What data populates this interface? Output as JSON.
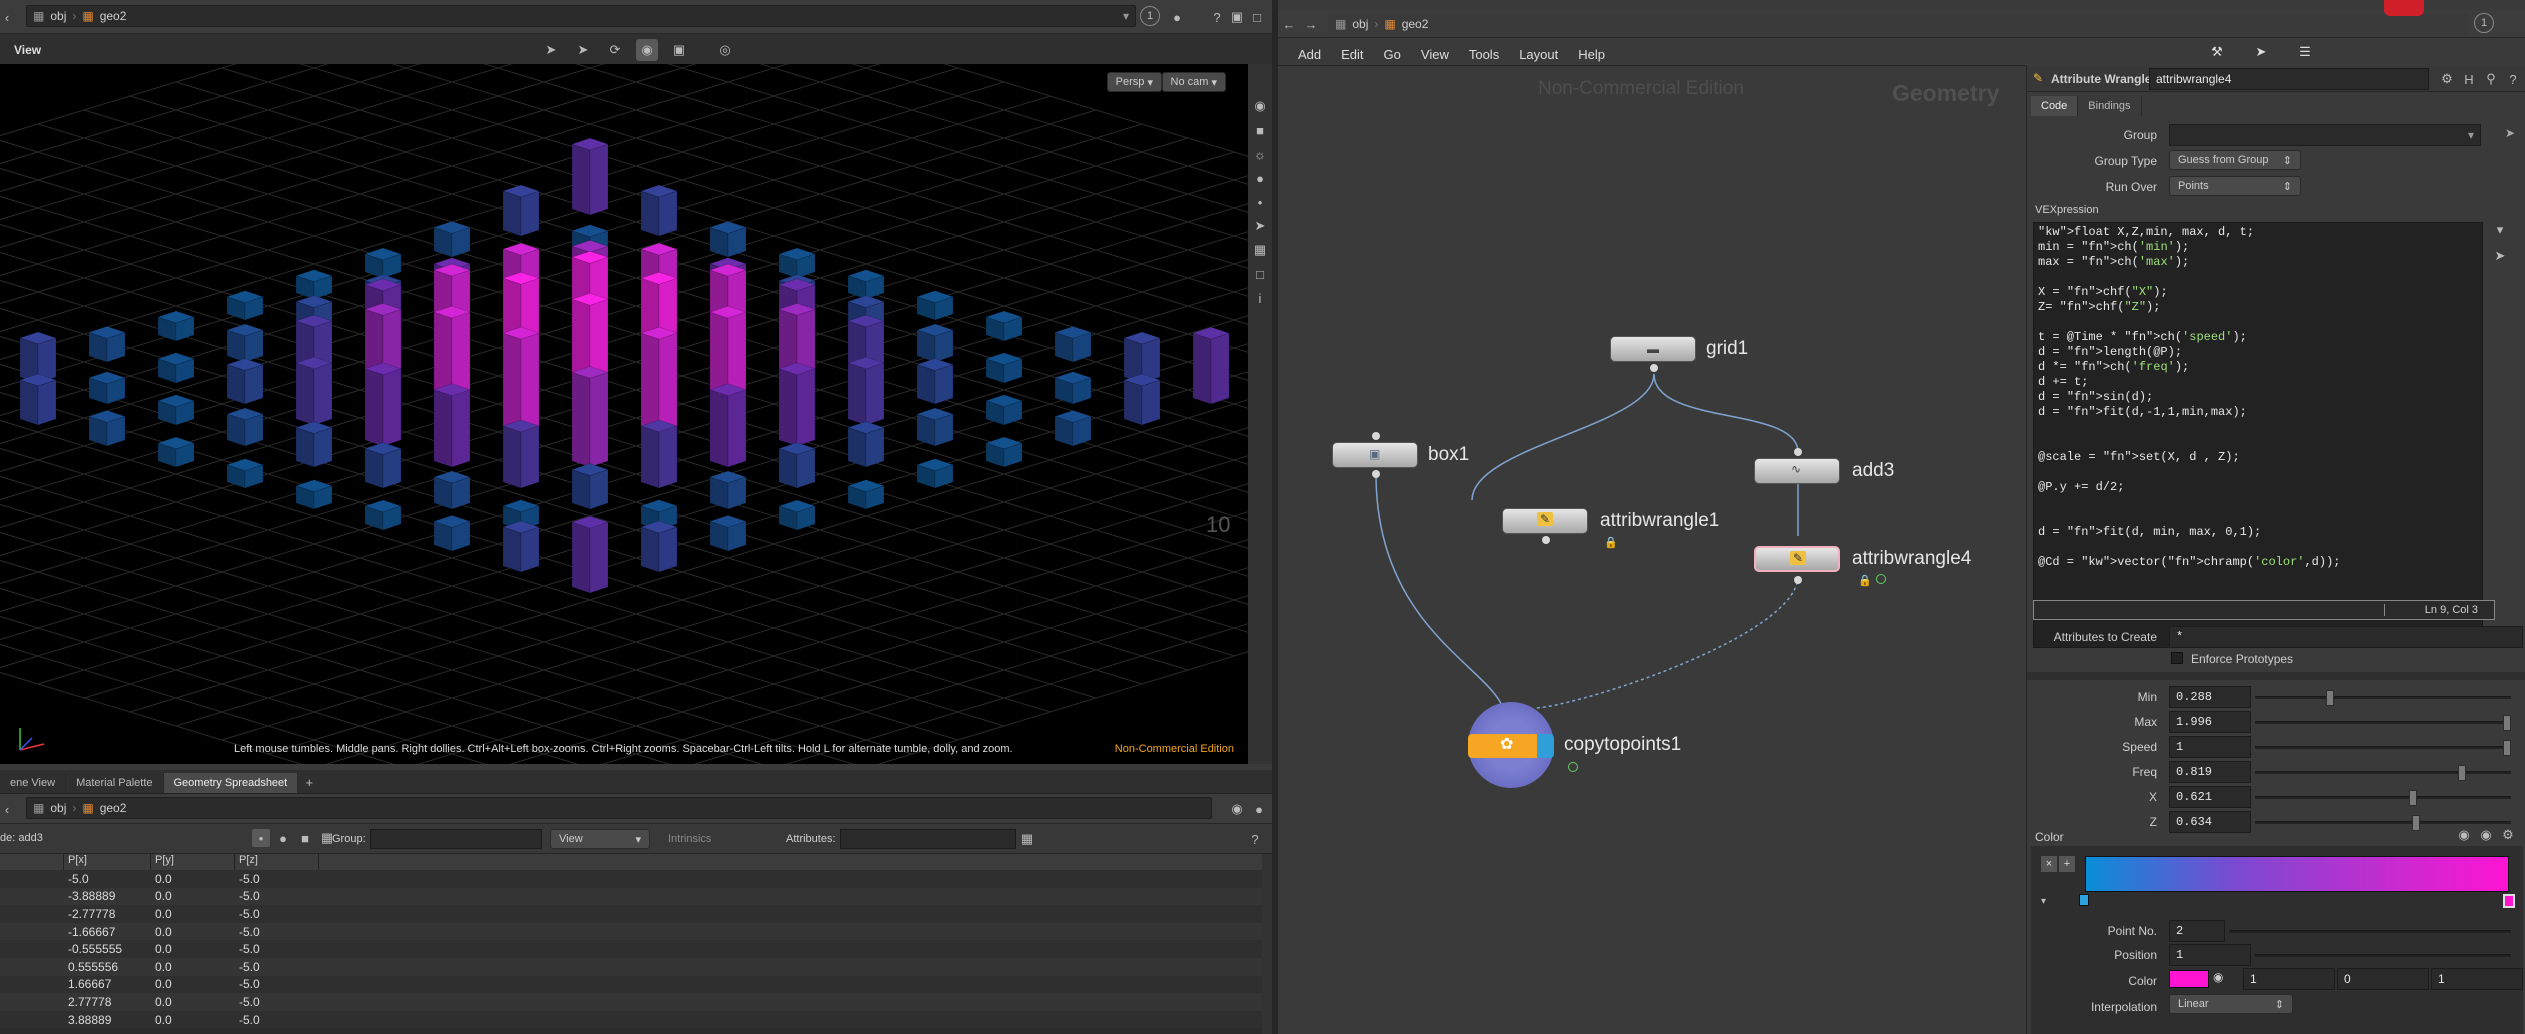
{
  "left_path": {
    "root": "obj",
    "node": "geo2"
  },
  "viewport": {
    "label": "View",
    "camera_persp": "Persp",
    "camera_name": "No cam",
    "status_hint": "Left mouse tumbles. Middle pans. Right dollies. Ctrl+Alt+Left box-zooms. Ctrl+Right zooms. Spacebar-Ctrl-Left tilts. Hold L for alternate tumble, dolly, and zoom.",
    "edition": "Non-Commercial Edition",
    "grid_text_a": "10",
    "grid_text_b": "10"
  },
  "bottom_tabs": [
    "ene View",
    "Material Palette",
    "Geometry Spreadsheet"
  ],
  "sheet": {
    "path": {
      "root": "obj",
      "node": "geo2"
    },
    "node_label": "de: add3",
    "group_label": "Group:",
    "view_label": "View",
    "intrinsics_label": "Intrinsics",
    "attributes_label": "Attributes:",
    "columns": [
      "P[x]",
      "P[y]",
      "P[z]"
    ],
    "rows": [
      [
        "-5.0",
        "0.0",
        "-5.0"
      ],
      [
        "-3.88889",
        "0.0",
        "-5.0"
      ],
      [
        "-2.77778",
        "0.0",
        "-5.0"
      ],
      [
        "-1.66667",
        "0.0",
        "-5.0"
      ],
      [
        "-0.555555",
        "0.0",
        "-5.0"
      ],
      [
        "0.555556",
        "0.0",
        "-5.0"
      ],
      [
        "1.66667",
        "0.0",
        "-5.0"
      ],
      [
        "2.77778",
        "0.0",
        "-5.0"
      ],
      [
        "3.88889",
        "0.0",
        "-5.0"
      ]
    ]
  },
  "network": {
    "path": {
      "root": "obj",
      "node": "geo2"
    },
    "menu": [
      "Add",
      "Edit",
      "Go",
      "View",
      "Tools",
      "Layout",
      "Help"
    ],
    "watermark": "Non-Commercial Edition",
    "context": "Geometry",
    "nodes": {
      "grid": "grid1",
      "box": "box1",
      "add": "add3",
      "wrangle1": "attribwrangle1",
      "wrangle4": "attribwrangle4",
      "copy": "copytopoints1"
    }
  },
  "params": {
    "node_type": "Attribute Wrangle",
    "node_name": "attribwrangle4",
    "tabs": [
      "Code",
      "Bindings"
    ],
    "group_label": "Group",
    "group_value": "",
    "group_type_label": "Group Type",
    "group_type_value": "Guess from Group",
    "run_over_label": "Run Over",
    "run_over_value": "Points",
    "vex_label": "VEXpression",
    "code_lines": [
      "float X,Z,min, max, d, t;",
      "min = ch('min');",
      "max = ch('max');",
      "",
      "X = chf(\"X\");",
      "Z= chf(\"Z\");",
      "",
      "t = @Time * ch('speed');",
      "d = length(@P);",
      "d *= ch('freq');",
      "d += t;",
      "d = sin(d);",
      "d = fit(d,-1,1,min,max);",
      "",
      "",
      "@scale = set(X, d , Z);",
      "",
      "@P.y += d/2;",
      "",
      "",
      "d = fit(d, min, max, 0,1);",
      "",
      "@Cd = vector(chramp('color',d));"
    ],
    "cursor_pos": "Ln 9, Col 3",
    "attr_create_label": "Attributes to Create",
    "attr_create_value": "*",
    "enforce_label": "Enforce Prototypes",
    "sliders": [
      {
        "label": "Min",
        "value": "0.288",
        "frac": 0.288
      },
      {
        "label": "Max",
        "value": "1.996",
        "frac": 0.998
      },
      {
        "label": "Speed",
        "value": "1",
        "frac": 1.0
      },
      {
        "label": "Freq",
        "value": "0.819",
        "frac": 0.819
      },
      {
        "label": "X",
        "value": "0.621",
        "frac": 0.621
      },
      {
        "label": "Z",
        "value": "0.634",
        "frac": 0.634
      }
    ],
    "color_label": "Color",
    "point_no_label": "Point No.",
    "point_no_value": "2",
    "position_label": "Position",
    "position_value": "1",
    "color_row_label": "Color",
    "color_r": "1",
    "color_g": "0",
    "color_b": "1",
    "interp_label": "Interpolation",
    "interp_value": "Linear"
  },
  "colors": {
    "magenta": "#e21fd0",
    "purple": "#6c2fa6",
    "blue": "#1d76b8",
    "ramp_start": "#0a8ed8",
    "ramp_end": "#ff14d2"
  }
}
